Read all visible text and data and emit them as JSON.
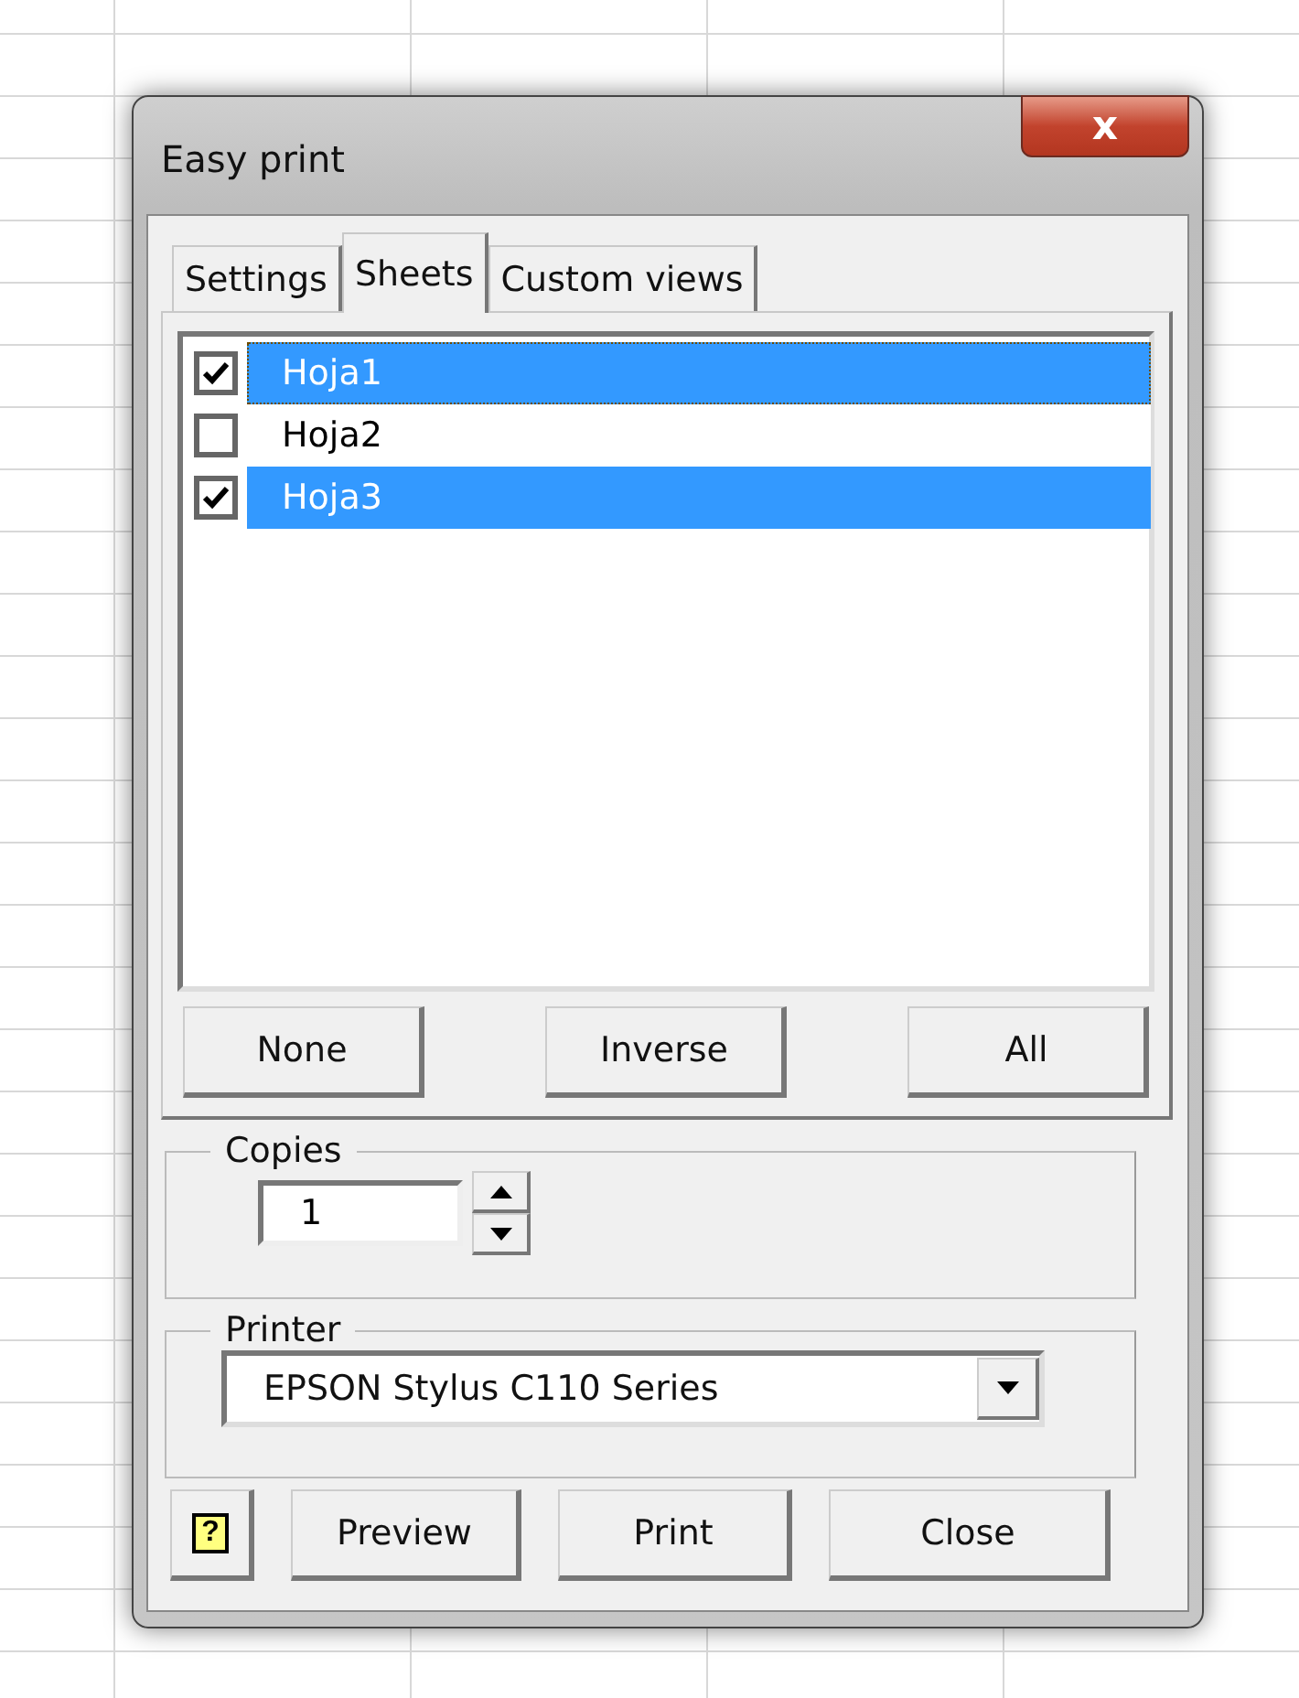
{
  "window": {
    "title": "Easy print",
    "close_label": "x"
  },
  "tabs": [
    {
      "label": "Settings",
      "selected": false
    },
    {
      "label": "Sheets",
      "selected": true
    },
    {
      "label": "Custom views",
      "selected": false
    }
  ],
  "sheets": [
    {
      "name": "Hoja1",
      "checked": true,
      "selected": true,
      "focused": true
    },
    {
      "name": "Hoja2",
      "checked": false,
      "selected": false,
      "focused": false
    },
    {
      "name": "Hoja3",
      "checked": true,
      "selected": true,
      "focused": false
    }
  ],
  "selection_buttons": [
    "None",
    "Inverse",
    "All"
  ],
  "copies": {
    "label": "Copies",
    "value": "1"
  },
  "printer": {
    "label": "Printer",
    "value": "EPSON Stylus C110 Series"
  },
  "help_button": {
    "label": "?"
  },
  "buttons": [
    "Preview",
    "Print",
    "Close"
  ]
}
